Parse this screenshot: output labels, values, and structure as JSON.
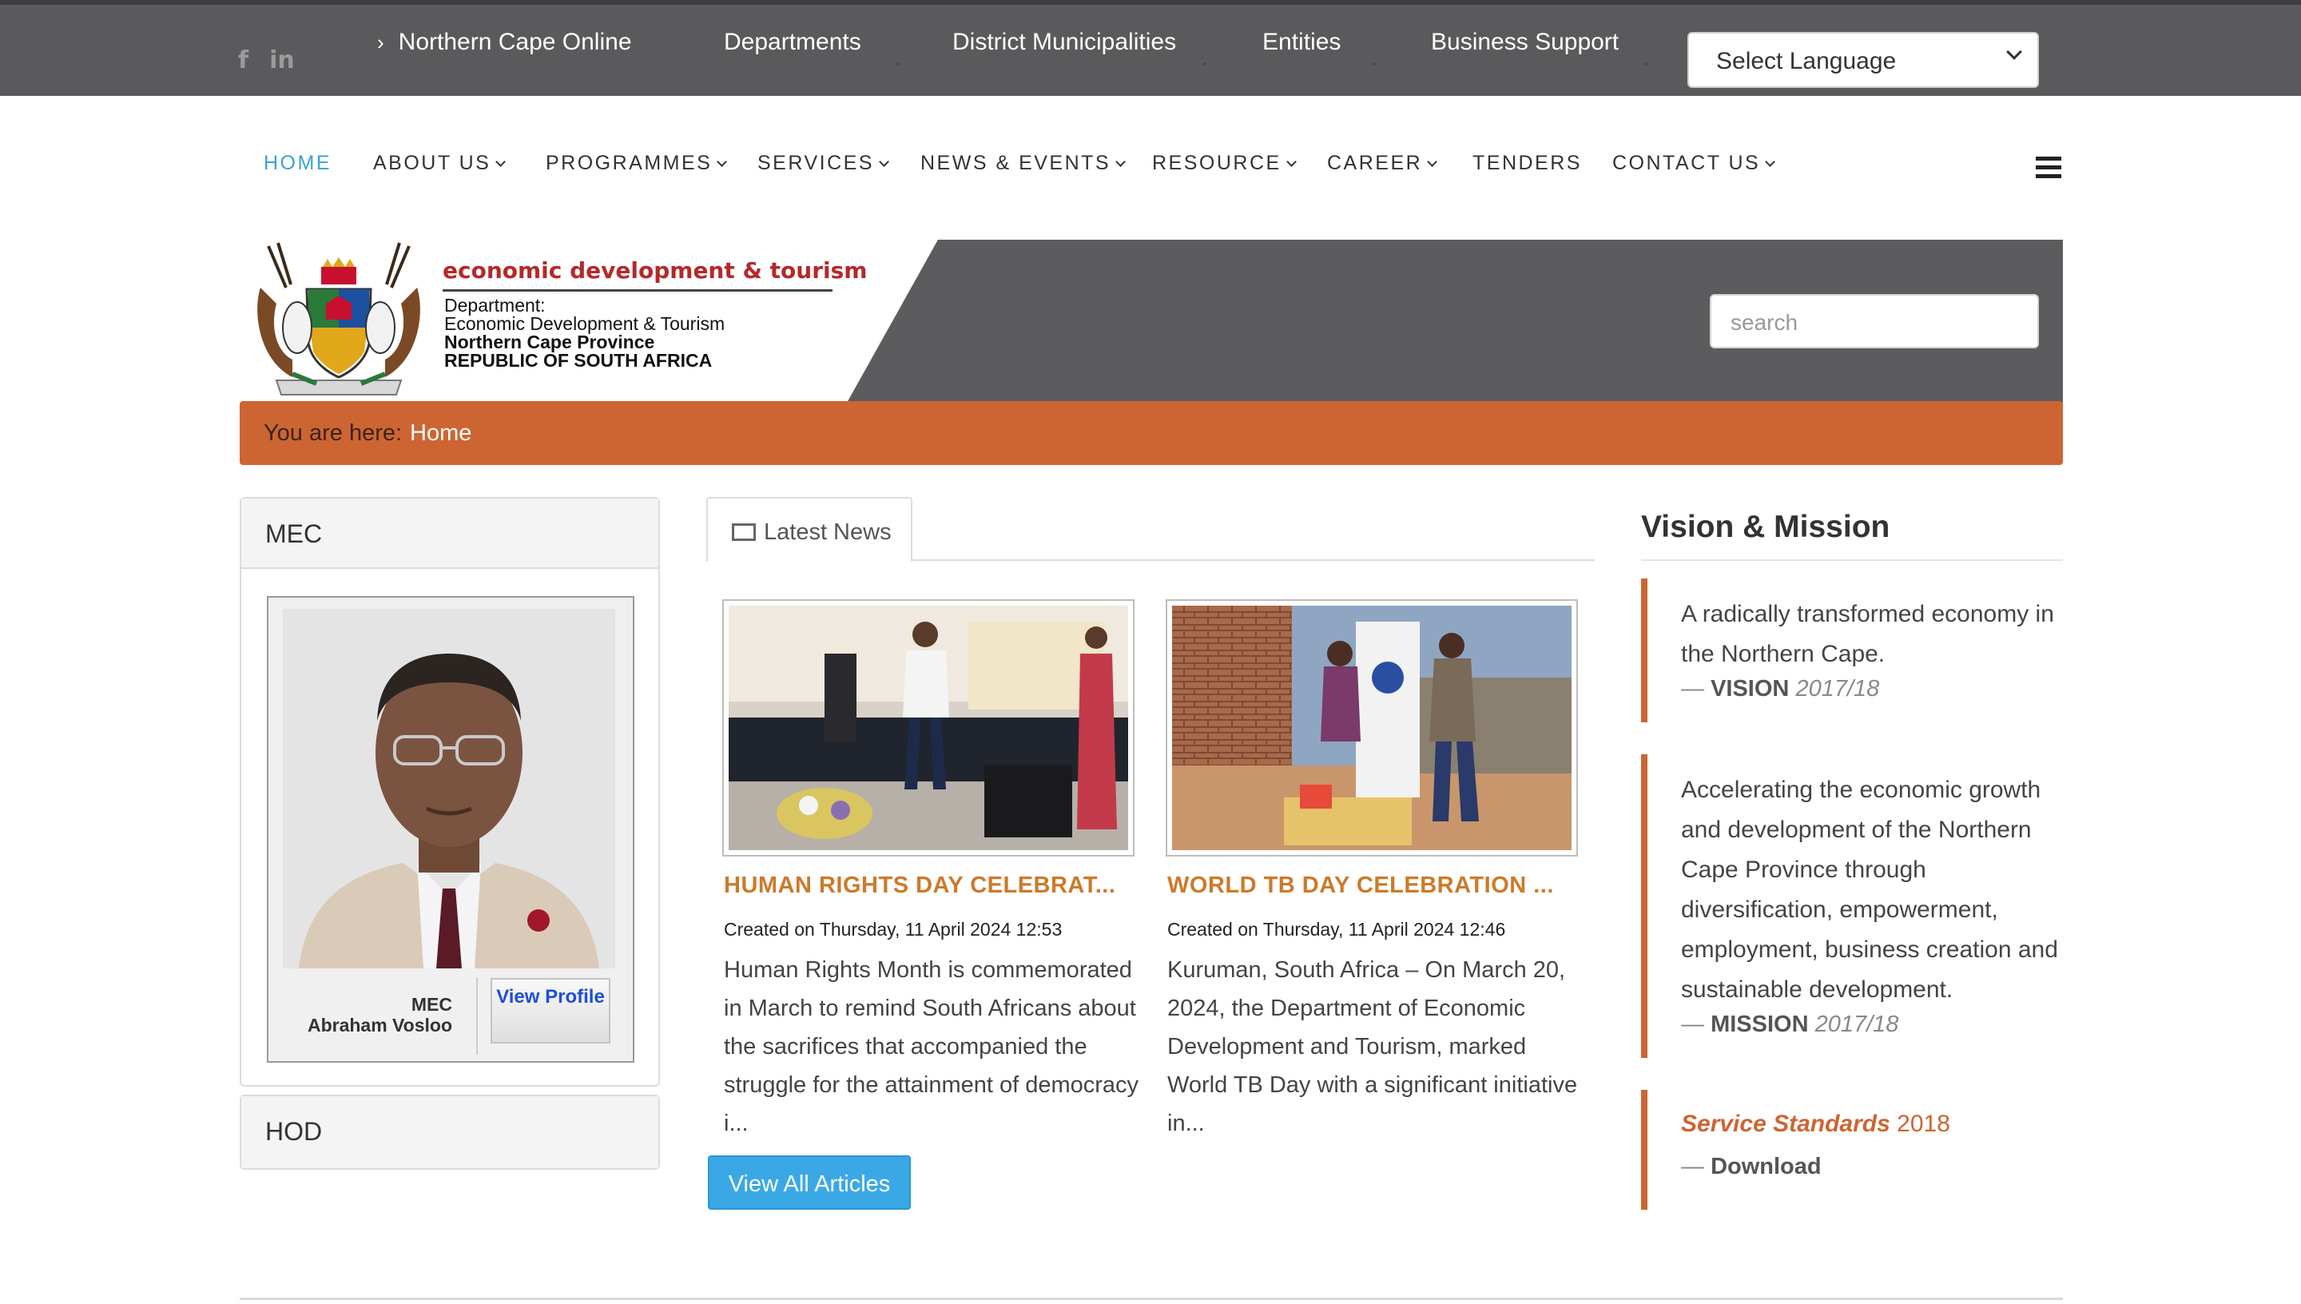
{
  "colors": {
    "topbar": "#5a5a5c",
    "accent_orange": "#cd6532",
    "link_blue": "#3ba1d8",
    "news_title": "#cc7a2a",
    "button_blue": "#3ba8e6"
  },
  "topbar": {
    "social": [
      {
        "icon": "facebook-icon",
        "label": "f"
      },
      {
        "icon": "linkedin-icon",
        "label": "in"
      }
    ],
    "links": [
      "Northern Cape Online",
      "Departments",
      "District Municipalities",
      "Entities",
      "Business Support"
    ],
    "language_select": "Select Language"
  },
  "mainnav": {
    "items": [
      "HOME",
      "ABOUT US",
      "PROGRAMMES",
      "SERVICES",
      "NEWS & EVENTS",
      "RESOURCE",
      "CAREER",
      "TENDERS",
      "CONTACT US"
    ],
    "active": "HOME"
  },
  "banner": {
    "logo_title": "economic development & tourism",
    "logo_lines": [
      "Department:",
      "Economic Development & Tourism",
      "Northern Cape Province",
      "REPUBLIC OF SOUTH AFRICA"
    ],
    "search_placeholder": "search"
  },
  "breadcrumb": {
    "label": "You are here:",
    "current": "Home"
  },
  "left": {
    "mec": {
      "heading": "MEC",
      "role": "MEC",
      "name": "Abraham Vosloo",
      "button": "View Profile"
    },
    "hod": {
      "heading": "HOD"
    }
  },
  "news": {
    "tab": "Latest News",
    "articles": [
      {
        "title": "HUMAN RIGHTS DAY CELEBRAT...",
        "date": "Created on Thursday, 11 April 2024 12:53",
        "body": "Human Rights Month is commemorated in March to remind South Africans about the sacrifices that accompanied the struggle for the attainment of democracy i..."
      },
      {
        "title": "WORLD TB DAY CELEBRATION ...",
        "date": "Created on Thursday, 11 April 2024 12:46",
        "body": "Kuruman, South Africa – On March 20, 2024, the Department of Economic Development and Tourism, marked World TB Day with a significant initiative in..."
      }
    ],
    "view_all": "View All Articles"
  },
  "vision_mission": {
    "heading": "Vision & Mission",
    "vision": {
      "text": "A radically transformed economy in the Northern Cape.",
      "dash": "—",
      "label": "VISION",
      "year": "2017/18"
    },
    "mission": {
      "text": "Accelerating the economic growth and development of the Northern Cape Province through diversification, empowerment, employment, business creation and sustainable development.",
      "dash": "—",
      "label": "MISSION",
      "year": "2017/18"
    },
    "service": {
      "title": "Service Standards",
      "year": "2018",
      "dash": "—",
      "link": "Download"
    }
  }
}
